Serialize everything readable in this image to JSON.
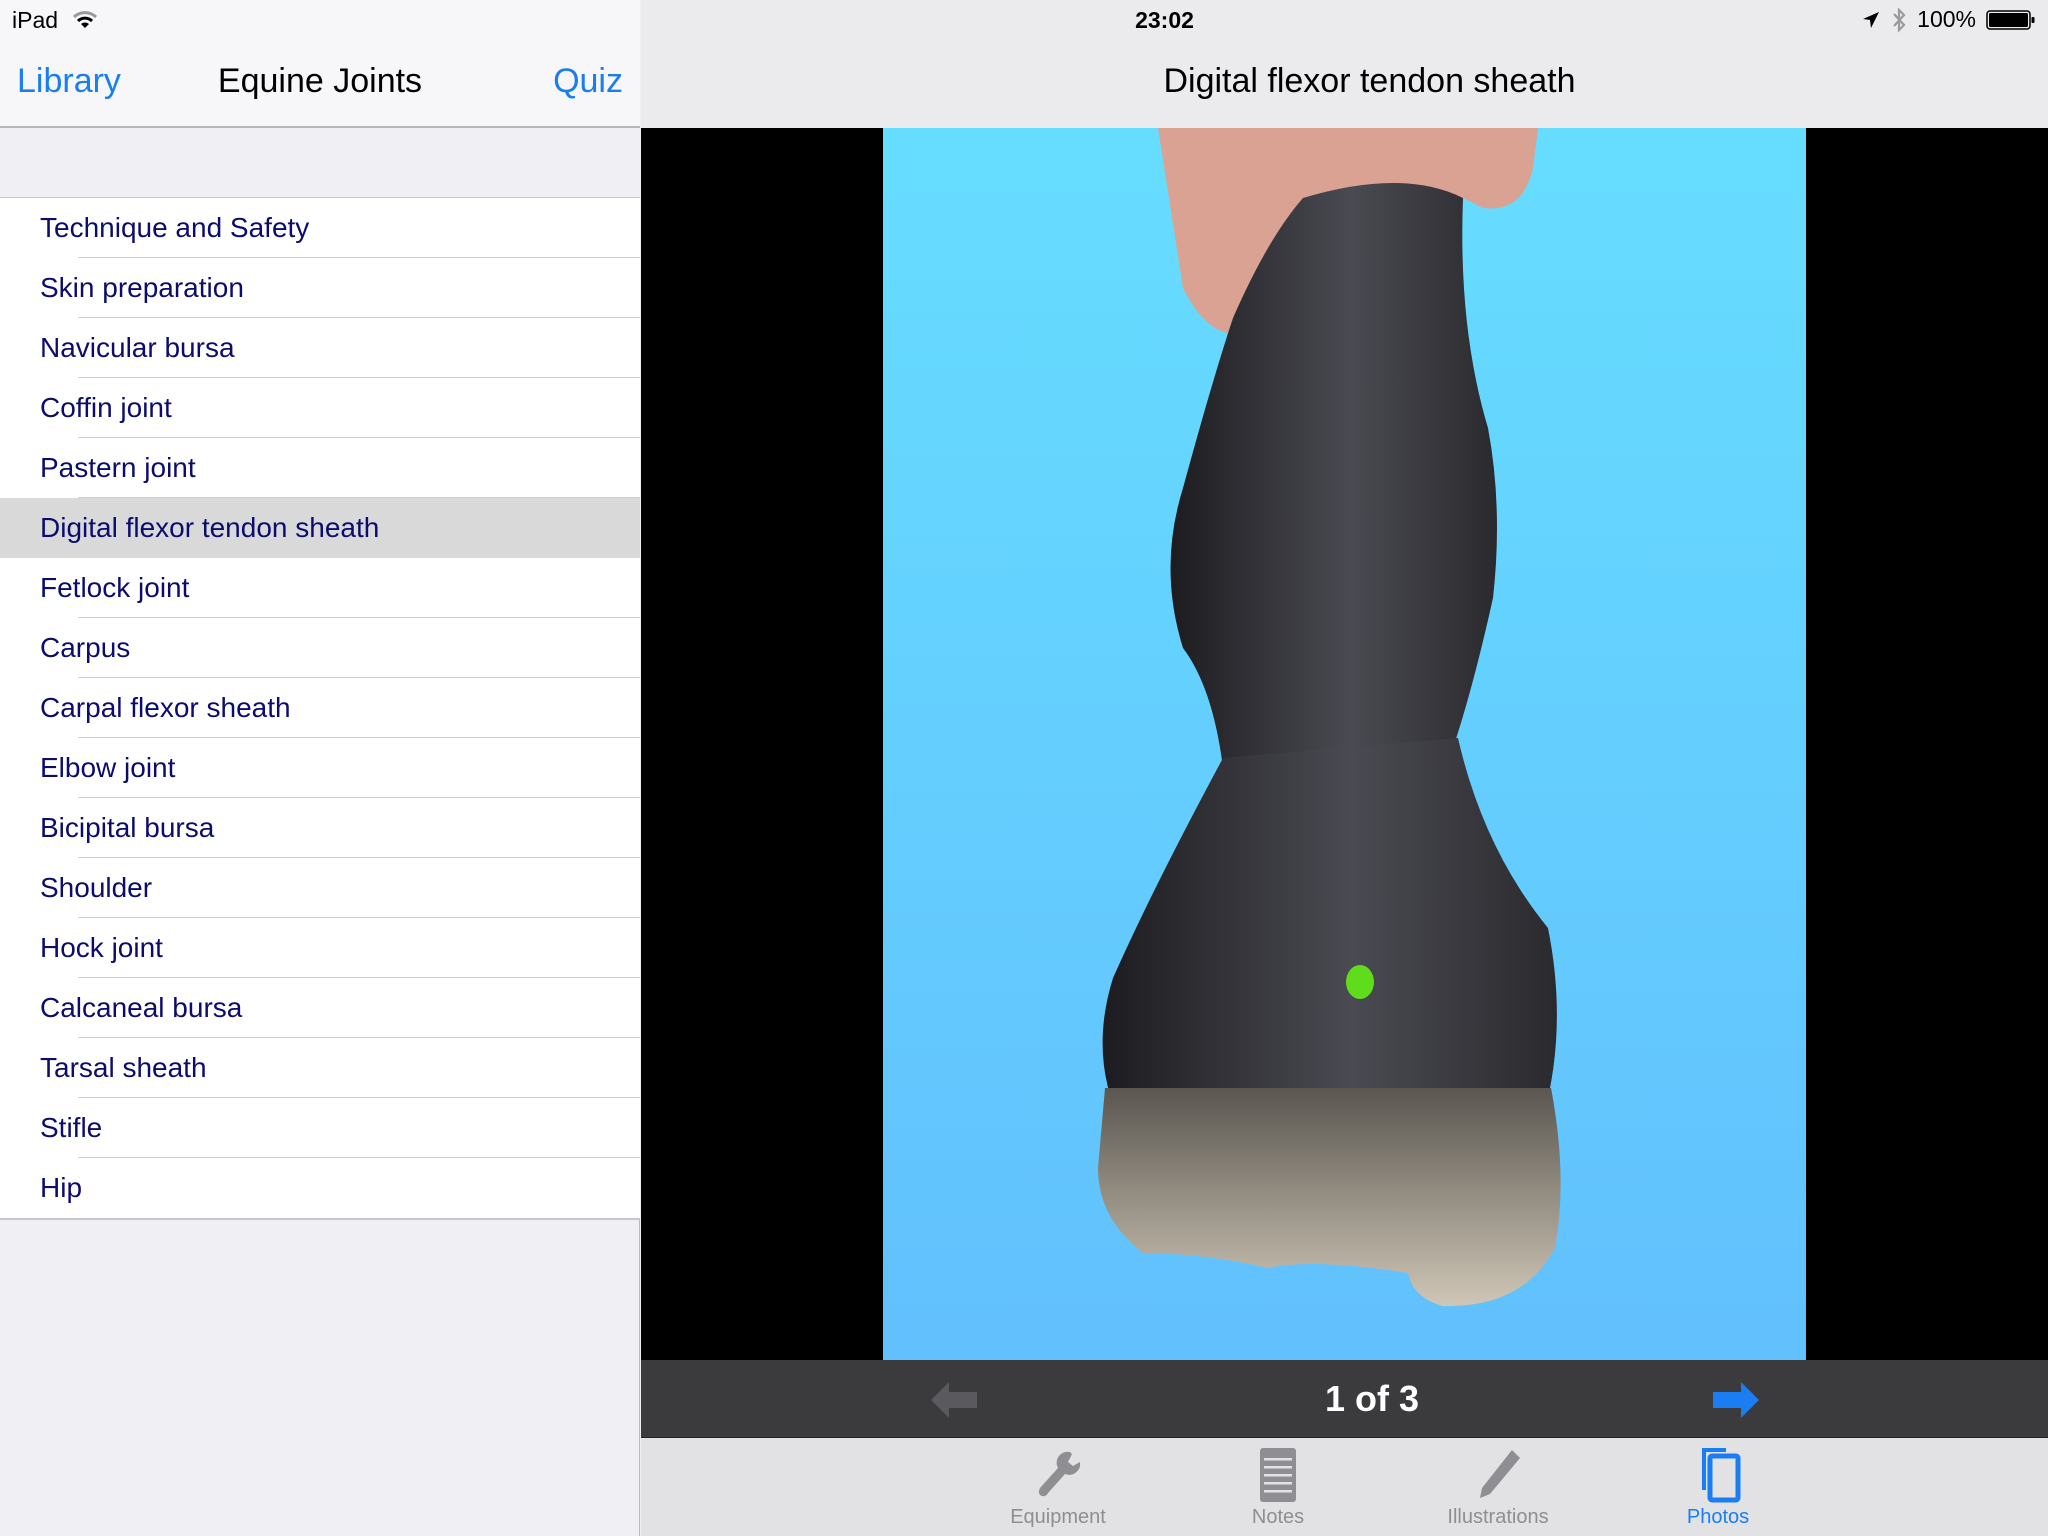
{
  "status_bar": {
    "device": "iPad",
    "time": "23:02",
    "battery": "100%"
  },
  "sidebar": {
    "back_label": "Library",
    "title": "Equine Joints",
    "quiz_label": "Quiz",
    "items": [
      {
        "label": "Technique and Safety"
      },
      {
        "label": "Skin preparation"
      },
      {
        "label": "Navicular bursa"
      },
      {
        "label": "Coffin joint"
      },
      {
        "label": "Pastern joint"
      },
      {
        "label": "Digital flexor tendon sheath",
        "selected": true
      },
      {
        "label": "Fetlock joint"
      },
      {
        "label": "Carpus"
      },
      {
        "label": "Carpal flexor sheath"
      },
      {
        "label": "Elbow joint"
      },
      {
        "label": "Bicipital bursa"
      },
      {
        "label": "Shoulder"
      },
      {
        "label": "Hock joint"
      },
      {
        "label": "Calcaneal bursa"
      },
      {
        "label": "Tarsal sheath"
      },
      {
        "label": "Stifle"
      },
      {
        "label": "Hip"
      }
    ]
  },
  "detail": {
    "title": "Digital flexor tendon sheath",
    "photo_description": "Horse lower limb held by a hand against blue background, green injection-site marker",
    "pager": "1 of 3",
    "prev_enabled": false,
    "next_enabled": true
  },
  "tabs": [
    {
      "label": "Equipment",
      "icon": "wrench-icon"
    },
    {
      "label": "Notes",
      "icon": "notepad-icon"
    },
    {
      "label": "Illustrations",
      "icon": "pencil-icon"
    },
    {
      "label": "Photos",
      "icon": "photos-icon",
      "active": true
    }
  ],
  "colors": {
    "accent": "#1a7ef2",
    "list_text": "#0c0c6e",
    "selected_row": "#d9d9d9",
    "marker": "#5fdc1c"
  }
}
